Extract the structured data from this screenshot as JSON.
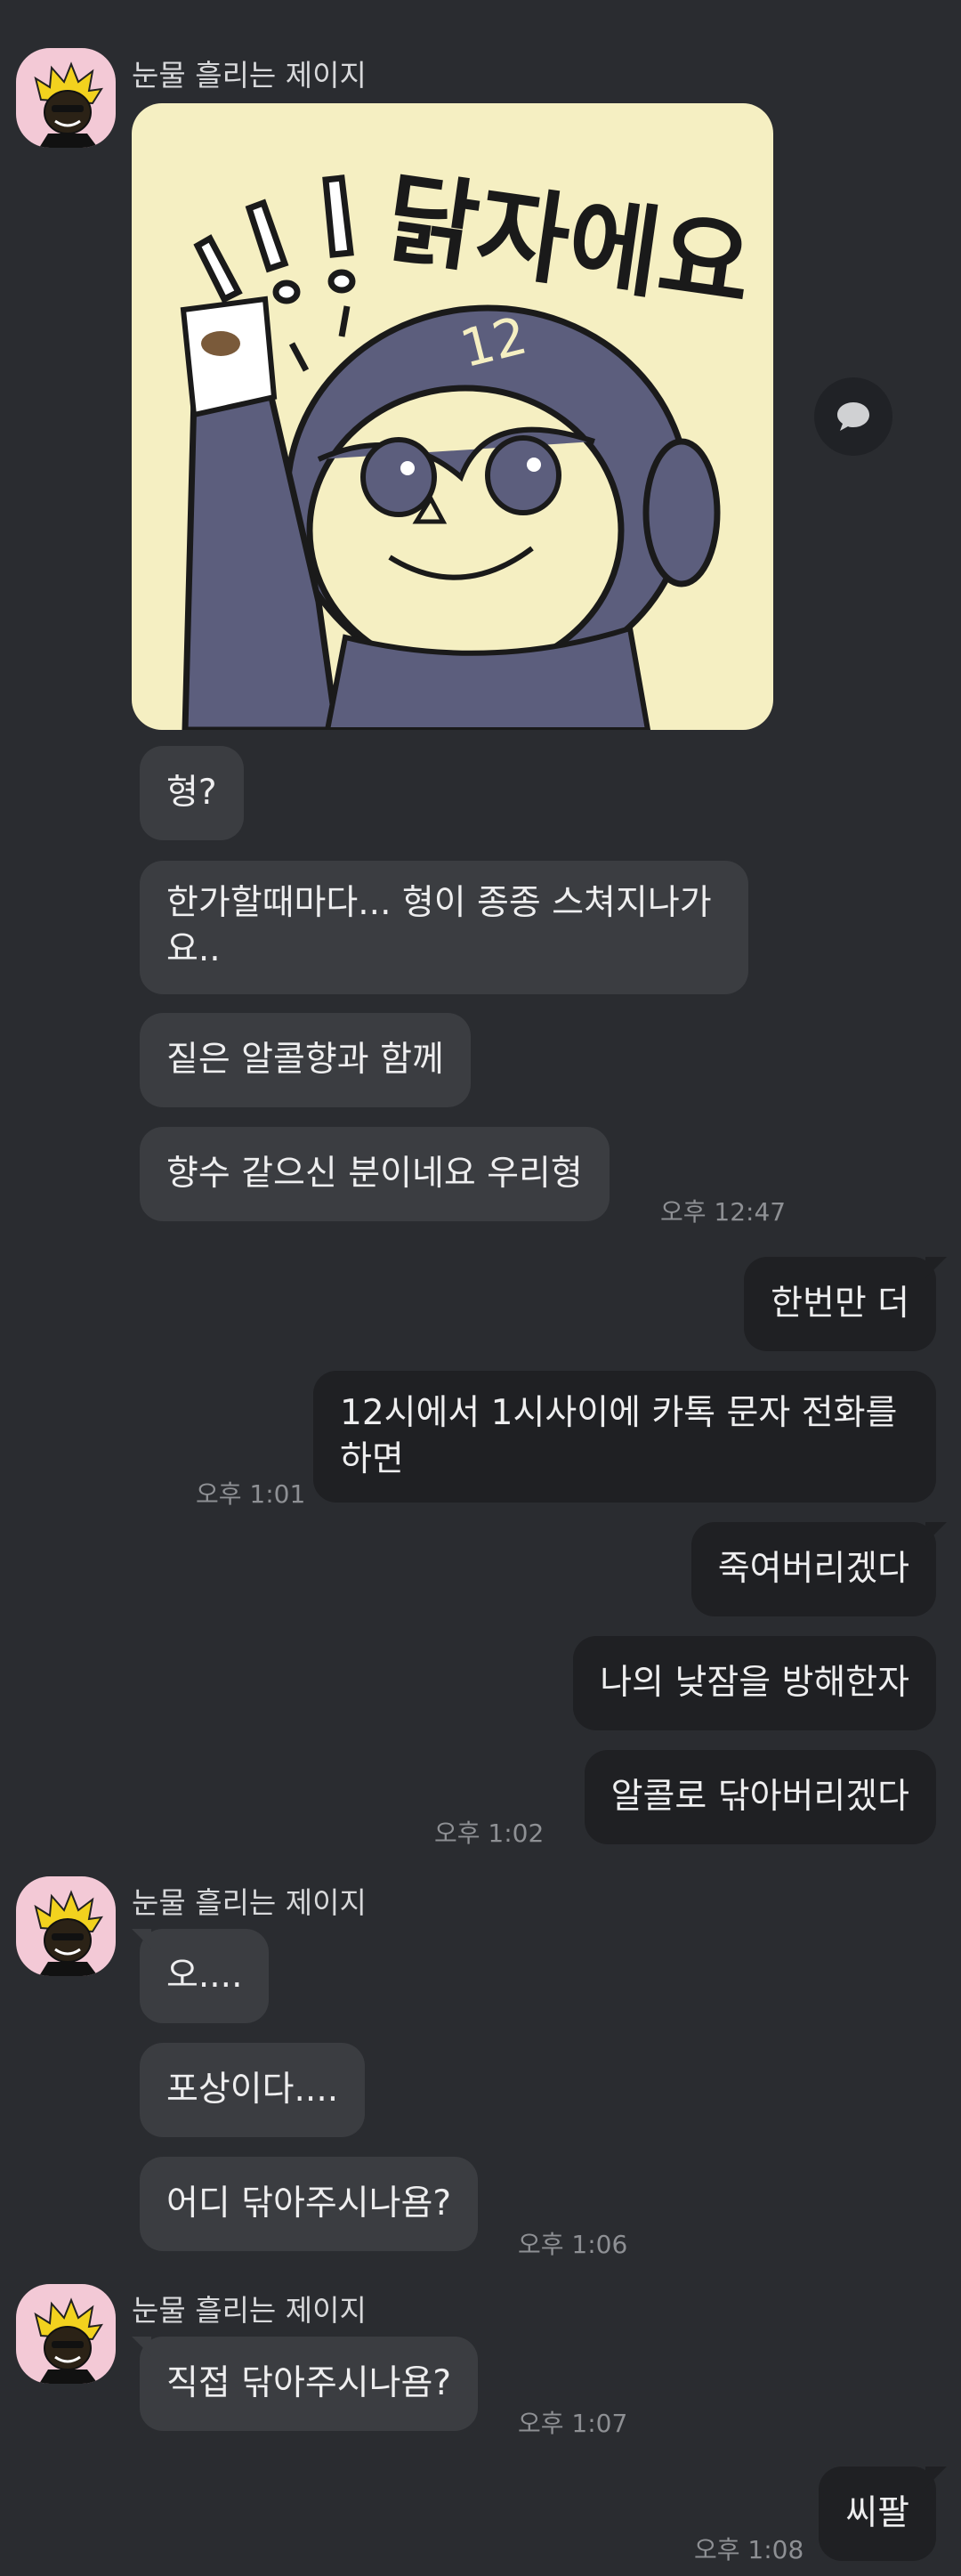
{
  "sender_name": "눈물 흘리는 제이지",
  "sticker": {
    "caption": "닭자에요",
    "helmet_number": "12"
  },
  "messages": {
    "m1": "형?",
    "m2": "한가할때마다... 형이 종종 스쳐지나가요..",
    "m3": "짙은 알콜향과 함께",
    "m4": "향수 같으신 분이네요 우리형",
    "t1": "오후 12:47",
    "m5": "한번만 더",
    "m6": "12시에서 1시사이에 카톡 문자 전화를 하면",
    "t2": "오후 1:01",
    "m7": "죽여버리겠다",
    "m8": "나의 낮잠을 방해한자",
    "m9": "알콜로 닦아버리겠다",
    "t3": "오후 1:02",
    "m10": "오....",
    "m11": "포상이다....",
    "m12": "어디 닦아주시나욤?",
    "t4": "오후 1:06",
    "m13": "직접 닦아주시나욤?",
    "t5": "오후 1:07",
    "m14": "씨팔",
    "t6": "오후 1:08"
  },
  "colors": {
    "background": "#2a2c30",
    "incoming_bubble": "#3b3d41",
    "outgoing_bubble": "#1f2023",
    "avatar_bg": "#f3c9d6"
  }
}
